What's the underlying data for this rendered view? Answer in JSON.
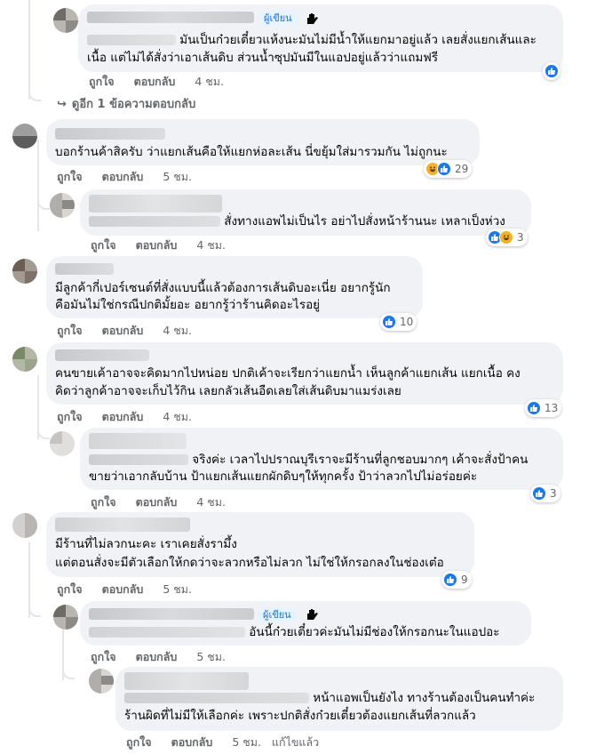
{
  "author_badge": "ผู้เขียน",
  "view_more": "ดูอีก 1 ข้อความตอบกลับ",
  "actions": {
    "like": "ถูกใจ",
    "reply": "ตอบกลับ",
    "edited": "แก้ไขแล้ว"
  },
  "comments": [
    {
      "lines": [
        "มันเป็นก๋วยเตี๋ยวแห้งนะมันไม่มีน้ำให้แยกมาอยู่แล้ว เลยสั่งแยกเส้นและ",
        "เนื้อ แต่ไม่ได้สั่งว่าเอาเส้นดิบ ส่วนน้ำซุปมันมีในแอปอยู่แล้วว่าแถมฟรี"
      ],
      "time": "4 ชม.",
      "reactions": {
        "icons": [
          "like-icon"
        ],
        "count": ""
      }
    },
    {
      "lines": [
        "บอกร้านค้าสิครับ ว่าแยกเส้นคือให้แยกห่อละเส้น นี่ขยุ้มใส่มารวมกัน ไม่ถูกนะ"
      ],
      "time": "5 ชม.",
      "reactions": {
        "icons": [
          "haha-icon",
          "like-icon"
        ],
        "count": "29"
      }
    },
    {
      "lines": [
        "สั่งทางแอพไม่เป็นไร อย่าไปสั่งหน้าร้านนะ เหลาเป็งห่วง"
      ],
      "time": "4 ชม.",
      "reactions": {
        "icons": [
          "like-icon",
          "haha-icon"
        ],
        "count": "3"
      }
    },
    {
      "lines": [
        "มีลูกค้ากี่เปอร์เซนต์ที่สั่งแบบนี้แล้วต้องการเส้นดิบอะเนี่ย อยากรู้นัก",
        "คือมันไม่ใช่กรณีปกติมั้ยอะ อยากรู้ว่าร้านคิดอะไรอยู่"
      ],
      "time": "4 ชม.",
      "reactions": {
        "icons": [
          "like-icon"
        ],
        "count": "10"
      }
    },
    {
      "lines": [
        "คนขายเค้าอาจจะคิดมากไปหน่อย ปกติเค้าจะเรียกว่าแยกน้ำ เห็นลูกค้าแยกเส้น แยกเนื้อ คง",
        "คิดว่าลูกค้าอาจจะเก็บไว้กิน เลยกลัวเส้นอืดเลยใส่เส้นดิบมาแมร่งเลย"
      ],
      "time": "4 ชม.",
      "reactions": {
        "icons": [
          "like-icon"
        ],
        "count": "13"
      }
    },
    {
      "lines": [
        "จริงค่ะ เวลาไปปราณบุรีเราจะมีร้านที่ลูกชอบมากๆ เค้าจะสั่งป้าคน",
        "ขายว่าเอากลับบ้าน ป้าแยกเส้นแยกผักดิบๆให้ทุกครั้ง ป้าว่าลวกไปไม่อร่อยค่ะ"
      ],
      "time": "4 ชม.",
      "reactions": {
        "icons": [
          "like-icon"
        ],
        "count": "3"
      }
    },
    {
      "lines": [
        "มีร้านที่ไม่ลวกนะคะ เราเคยสั่งรามึ้ง",
        "แต่ตอนสั่งจะมีตัวเลือกให้กดว่าจะลวกหรือไม่ลวก ไม่ใช่ให้กรอกลงในช่องเต๋อ"
      ],
      "time": "5 ชม.",
      "reactions": {
        "icons": [
          "like-icon"
        ],
        "count": "9"
      }
    },
    {
      "lines": [
        "อันนี้ก๋วยเตี๋ยวค่ะมันไม่มีช่องให้กรอกนะในแอปอะ"
      ],
      "time": "5 ชม.",
      "reactions": {
        "icons": [],
        "count": ""
      }
    },
    {
      "lines": [
        "หน้าแอพเป็นยังไง ทางร้านต้องเป็นคนทำค่ะ",
        "ร้านผิดที่ไม่มีให้เลือกค่ะ เพราะปกติสั่งก๋วยเตี๋ยวต้องแยกเส้นที่ลวกแล้ว"
      ],
      "time": "5 ชม.",
      "reactions": {
        "icons": [],
        "count": ""
      }
    }
  ]
}
